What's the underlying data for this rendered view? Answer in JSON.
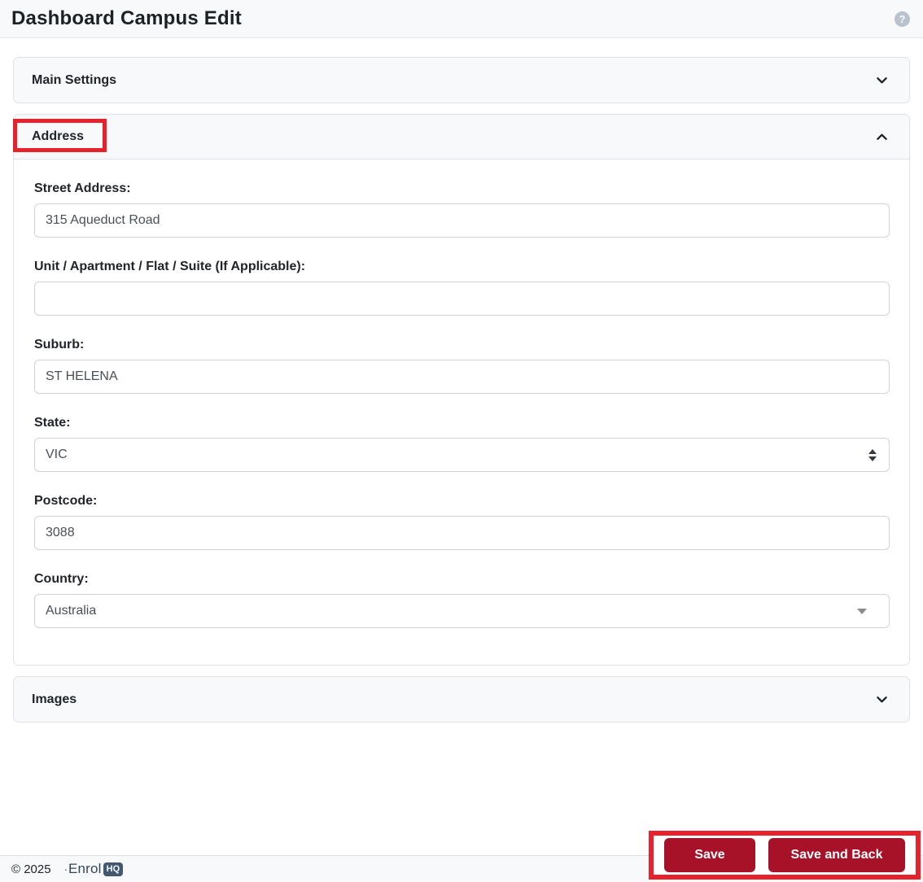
{
  "header": {
    "title": "Dashboard Campus Edit",
    "help_glyph": "?"
  },
  "sections": [
    {
      "label": "Main Settings",
      "state": "collapsed"
    },
    {
      "label": "Address",
      "state": "expanded"
    },
    {
      "label": "Images",
      "state": "collapsed"
    }
  ],
  "address_form": {
    "fields": [
      {
        "label": "Street Address:",
        "value": "315 Aqueduct Road",
        "type": "text"
      },
      {
        "label": "Unit / Apartment / Flat / Suite (If Applicable):",
        "value": "",
        "type": "text"
      },
      {
        "label": "Suburb:",
        "value": "ST HELENA",
        "type": "text"
      },
      {
        "label": "State:",
        "value": "VIC",
        "type": "select"
      },
      {
        "label": "Postcode:",
        "value": "3088",
        "type": "text"
      },
      {
        "label": "Country:",
        "value": "Australia",
        "type": "select"
      }
    ]
  },
  "actions": {
    "save_label": "Save",
    "save_and_back_label": "Save and Back"
  },
  "footer": {
    "copyright": "© 2025",
    "logo": {
      "prefix": "·",
      "text": "Enrol",
      "badge": "HQ"
    }
  },
  "icons": {
    "help": "question-mark-circle-icon",
    "main_settings": "chevron-down-icon",
    "address": "chevron-up-icon",
    "images": "chevron-down-icon",
    "state_field": "up-down-arrows-icon",
    "country_field": "down-triangle-icon"
  },
  "colors": {
    "button_red": "#a81228",
    "annotation_red": "#e8222d",
    "header_bg": "#f8f9fa",
    "card_border": "#dee2e6",
    "input_border": "#ced4da",
    "input_text": "#495057",
    "logo_navy": "#33475b"
  }
}
